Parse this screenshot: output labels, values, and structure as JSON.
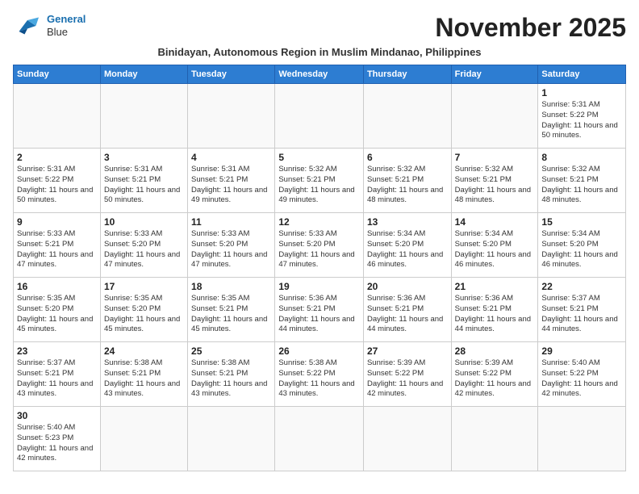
{
  "header": {
    "logo_line1": "General",
    "logo_line2": "Blue",
    "month_year": "November 2025",
    "subtitle": "Binidayan, Autonomous Region in Muslim Mindanao, Philippines"
  },
  "days_of_week": [
    "Sunday",
    "Monday",
    "Tuesday",
    "Wednesday",
    "Thursday",
    "Friday",
    "Saturday"
  ],
  "weeks": [
    [
      {
        "day": "",
        "info": ""
      },
      {
        "day": "",
        "info": ""
      },
      {
        "day": "",
        "info": ""
      },
      {
        "day": "",
        "info": ""
      },
      {
        "day": "",
        "info": ""
      },
      {
        "day": "",
        "info": ""
      },
      {
        "day": "1",
        "info": "Sunrise: 5:31 AM\nSunset: 5:22 PM\nDaylight: 11 hours\nand 50 minutes."
      }
    ],
    [
      {
        "day": "2",
        "info": "Sunrise: 5:31 AM\nSunset: 5:22 PM\nDaylight: 11 hours\nand 50 minutes."
      },
      {
        "day": "3",
        "info": "Sunrise: 5:31 AM\nSunset: 5:21 PM\nDaylight: 11 hours\nand 50 minutes."
      },
      {
        "day": "4",
        "info": "Sunrise: 5:31 AM\nSunset: 5:21 PM\nDaylight: 11 hours\nand 49 minutes."
      },
      {
        "day": "5",
        "info": "Sunrise: 5:32 AM\nSunset: 5:21 PM\nDaylight: 11 hours\nand 49 minutes."
      },
      {
        "day": "6",
        "info": "Sunrise: 5:32 AM\nSunset: 5:21 PM\nDaylight: 11 hours\nand 48 minutes."
      },
      {
        "day": "7",
        "info": "Sunrise: 5:32 AM\nSunset: 5:21 PM\nDaylight: 11 hours\nand 48 minutes."
      },
      {
        "day": "8",
        "info": "Sunrise: 5:32 AM\nSunset: 5:21 PM\nDaylight: 11 hours\nand 48 minutes."
      }
    ],
    [
      {
        "day": "9",
        "info": "Sunrise: 5:33 AM\nSunset: 5:21 PM\nDaylight: 11 hours\nand 47 minutes."
      },
      {
        "day": "10",
        "info": "Sunrise: 5:33 AM\nSunset: 5:20 PM\nDaylight: 11 hours\nand 47 minutes."
      },
      {
        "day": "11",
        "info": "Sunrise: 5:33 AM\nSunset: 5:20 PM\nDaylight: 11 hours\nand 47 minutes."
      },
      {
        "day": "12",
        "info": "Sunrise: 5:33 AM\nSunset: 5:20 PM\nDaylight: 11 hours\nand 47 minutes."
      },
      {
        "day": "13",
        "info": "Sunrise: 5:34 AM\nSunset: 5:20 PM\nDaylight: 11 hours\nand 46 minutes."
      },
      {
        "day": "14",
        "info": "Sunrise: 5:34 AM\nSunset: 5:20 PM\nDaylight: 11 hours\nand 46 minutes."
      },
      {
        "day": "15",
        "info": "Sunrise: 5:34 AM\nSunset: 5:20 PM\nDaylight: 11 hours\nand 46 minutes."
      }
    ],
    [
      {
        "day": "16",
        "info": "Sunrise: 5:35 AM\nSunset: 5:20 PM\nDaylight: 11 hours\nand 45 minutes."
      },
      {
        "day": "17",
        "info": "Sunrise: 5:35 AM\nSunset: 5:20 PM\nDaylight: 11 hours\nand 45 minutes."
      },
      {
        "day": "18",
        "info": "Sunrise: 5:35 AM\nSunset: 5:21 PM\nDaylight: 11 hours\nand 45 minutes."
      },
      {
        "day": "19",
        "info": "Sunrise: 5:36 AM\nSunset: 5:21 PM\nDaylight: 11 hours\nand 44 minutes."
      },
      {
        "day": "20",
        "info": "Sunrise: 5:36 AM\nSunset: 5:21 PM\nDaylight: 11 hours\nand 44 minutes."
      },
      {
        "day": "21",
        "info": "Sunrise: 5:36 AM\nSunset: 5:21 PM\nDaylight: 11 hours\nand 44 minutes."
      },
      {
        "day": "22",
        "info": "Sunrise: 5:37 AM\nSunset: 5:21 PM\nDaylight: 11 hours\nand 44 minutes."
      }
    ],
    [
      {
        "day": "23",
        "info": "Sunrise: 5:37 AM\nSunset: 5:21 PM\nDaylight: 11 hours\nand 43 minutes."
      },
      {
        "day": "24",
        "info": "Sunrise: 5:38 AM\nSunset: 5:21 PM\nDaylight: 11 hours\nand 43 minutes."
      },
      {
        "day": "25",
        "info": "Sunrise: 5:38 AM\nSunset: 5:21 PM\nDaylight: 11 hours\nand 43 minutes."
      },
      {
        "day": "26",
        "info": "Sunrise: 5:38 AM\nSunset: 5:22 PM\nDaylight: 11 hours\nand 43 minutes."
      },
      {
        "day": "27",
        "info": "Sunrise: 5:39 AM\nSunset: 5:22 PM\nDaylight: 11 hours\nand 42 minutes."
      },
      {
        "day": "28",
        "info": "Sunrise: 5:39 AM\nSunset: 5:22 PM\nDaylight: 11 hours\nand 42 minutes."
      },
      {
        "day": "29",
        "info": "Sunrise: 5:40 AM\nSunset: 5:22 PM\nDaylight: 11 hours\nand 42 minutes."
      }
    ],
    [
      {
        "day": "30",
        "info": "Sunrise: 5:40 AM\nSunset: 5:23 PM\nDaylight: 11 hours\nand 42 minutes."
      },
      {
        "day": "",
        "info": ""
      },
      {
        "day": "",
        "info": ""
      },
      {
        "day": "",
        "info": ""
      },
      {
        "day": "",
        "info": ""
      },
      {
        "day": "",
        "info": ""
      },
      {
        "day": "",
        "info": ""
      }
    ]
  ]
}
